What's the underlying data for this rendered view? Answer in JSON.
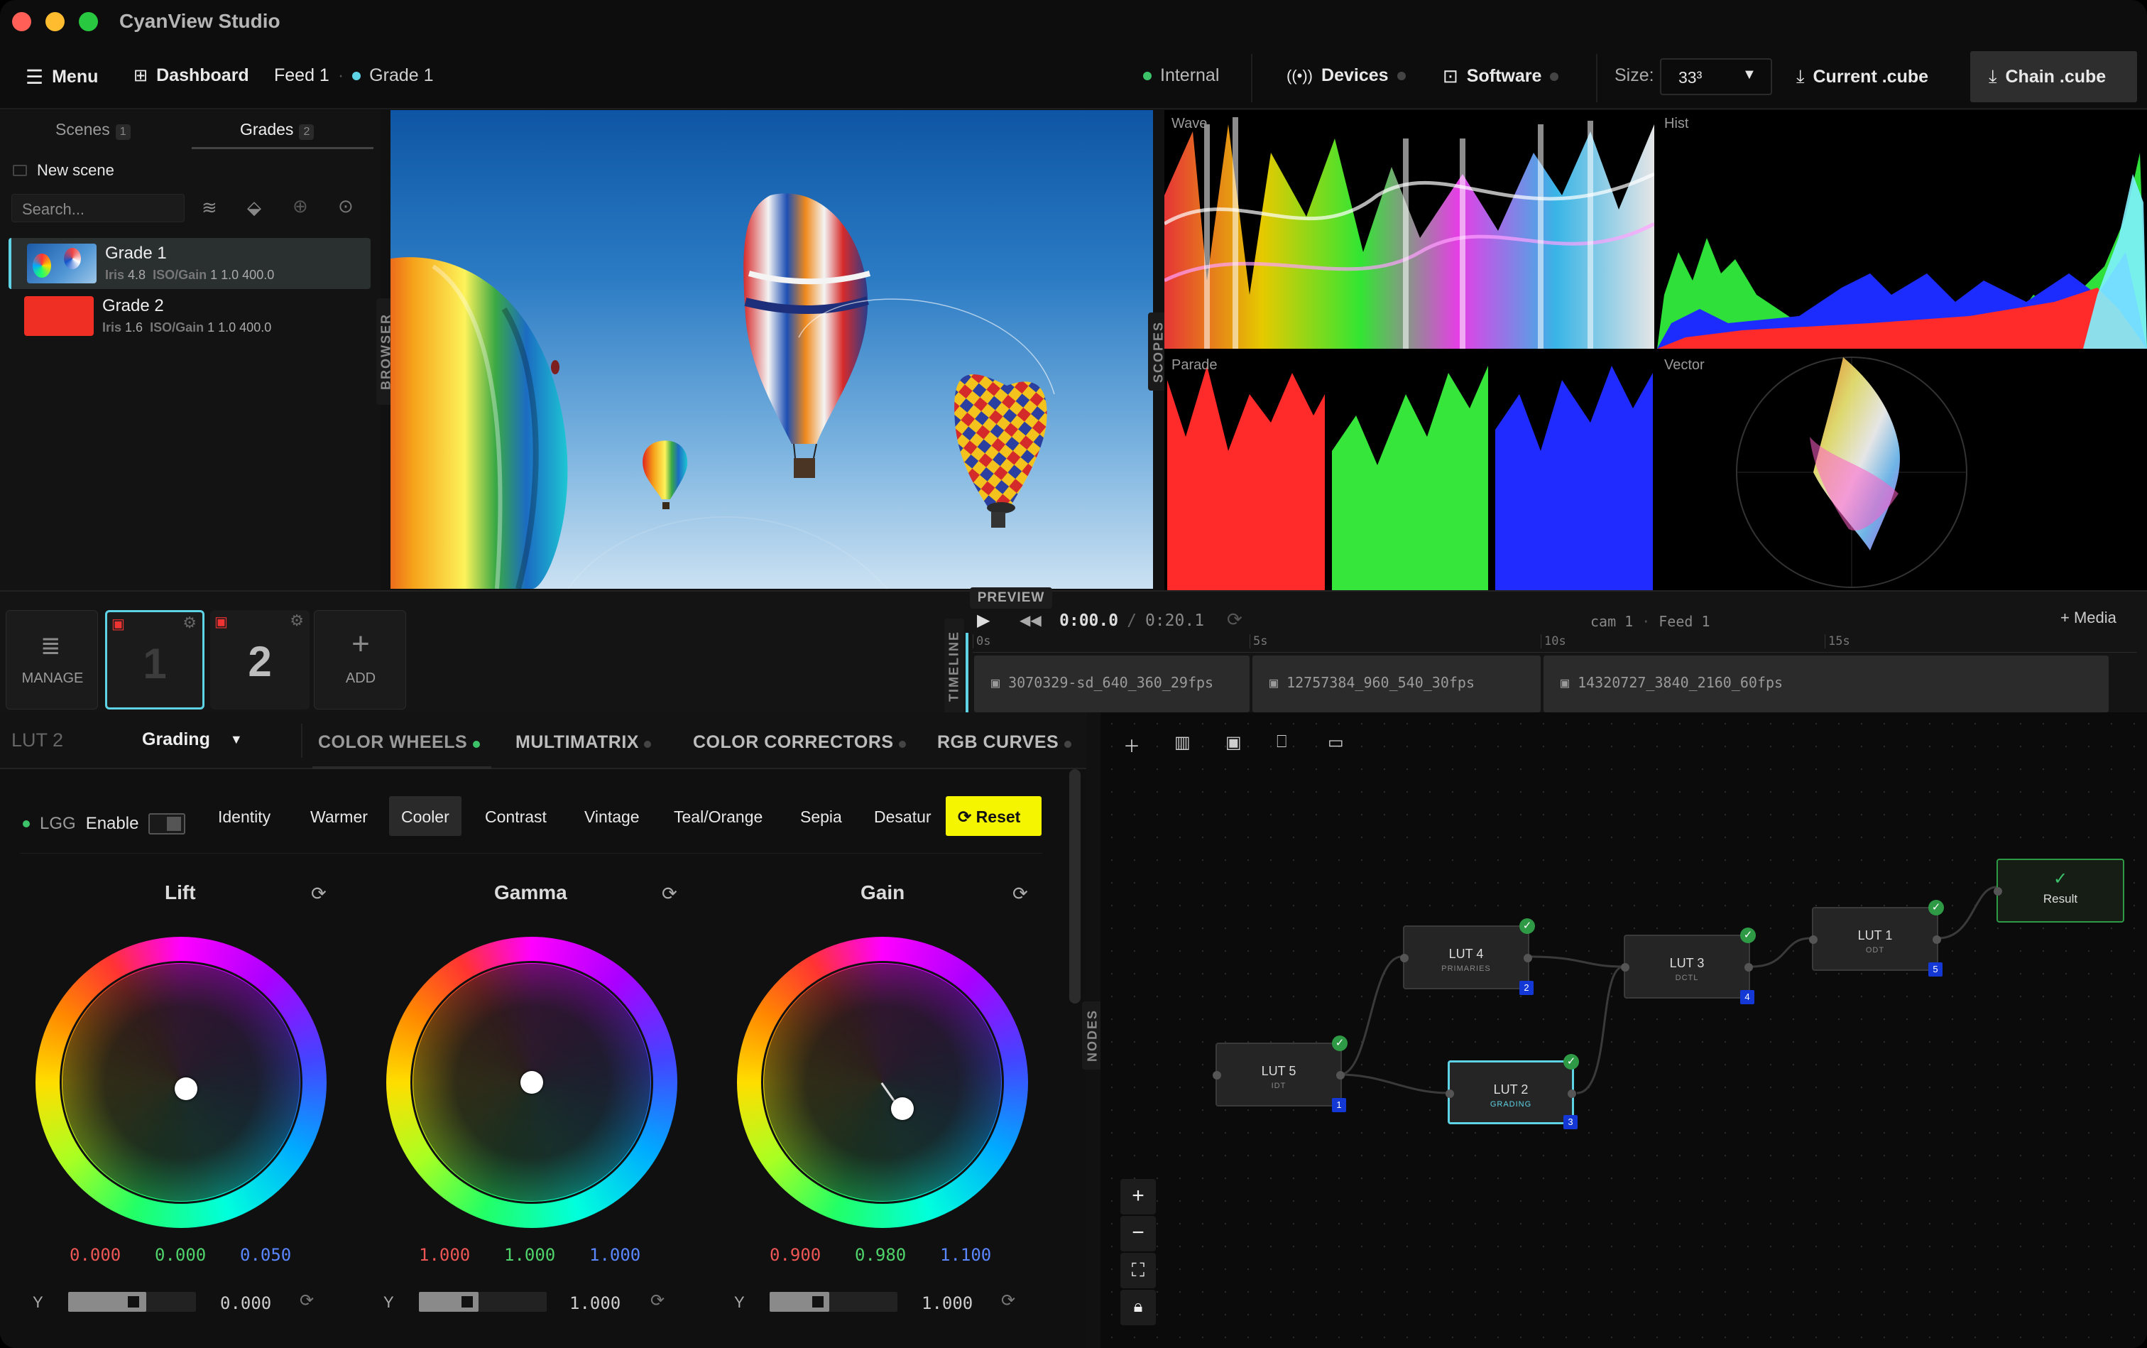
{
  "app": {
    "title": "CyanView Studio"
  },
  "toolbar": {
    "menu": "Menu",
    "dashboard": "Dashboard",
    "feed": "Feed 1",
    "grade": "Grade 1",
    "internal": "Internal",
    "devices": "Devices",
    "software": "Software",
    "size_label": "Size:",
    "size_value": "33³",
    "current_cube": "Current .cube",
    "chain_cube": "Chain .cube"
  },
  "sidebar": {
    "tabs": [
      {
        "label": "Scenes",
        "count": "1"
      },
      {
        "label": "Grades",
        "count": "2"
      }
    ],
    "new_scene": "New scene",
    "search_placeholder": "Search...",
    "grades": [
      {
        "name": "Grade 1",
        "meta": "Iris",
        "iris": "4.8",
        "gain": "ISO/Gain",
        "gainval": "1 1.0 400.0"
      },
      {
        "name": "Grade 2",
        "meta": "Iris",
        "iris": "1.6",
        "gain": "ISO/Gain",
        "gainval": "1 1.0 400.0"
      }
    ],
    "browser_tab": "BROWSER"
  },
  "scopes": {
    "tab": "SCOPES",
    "wave": "Wave",
    "hist": "Hist",
    "parade": "Parade",
    "vector": "Vector"
  },
  "strip": {
    "manage": "MANAGE",
    "cam1": "1",
    "cam2": "2",
    "add": "ADD",
    "preview": "PREVIEW",
    "timeline_tab": "TIMELINE",
    "time": "0:00.0",
    "duration": "0:20.1",
    "cam": "cam 1",
    "feed": "Feed 1",
    "media": "Media",
    "ticks": [
      "0s",
      "5s",
      "10s",
      "15s"
    ],
    "clips": [
      "3070329-sd_640_360_29fps",
      "12757384_960_540_30fps",
      "14320727_3840_2160_60fps"
    ]
  },
  "panel": {
    "lut": "LUT 2",
    "mode": "Grading",
    "tabs": [
      "COLOR WHEELS",
      "MULTIMATRIX",
      "COLOR CORRECTORS",
      "RGB CURVES"
    ],
    "lgg": "LGG",
    "enable": "Enable",
    "presets": [
      "Identity",
      "Warmer",
      "Cooler",
      "Contrast",
      "Vintage",
      "Teal/Orange",
      "Sepia",
      "Desatur"
    ],
    "reset": "Reset",
    "wheels": [
      {
        "title": "Lift",
        "r": "0.000",
        "g": "0.000",
        "b": "0.050",
        "y_label": "Y",
        "y": "0.000"
      },
      {
        "title": "Gamma",
        "r": "1.000",
        "g": "1.000",
        "b": "1.000",
        "y_label": "Y",
        "y": "1.000"
      },
      {
        "title": "Gain",
        "r": "0.900",
        "g": "0.980",
        "b": "1.100",
        "y_label": "Y",
        "y": "1.000"
      }
    ]
  },
  "nodes": {
    "tab": "NODES",
    "items": [
      {
        "title": "LUT 5",
        "sub": "IDT",
        "num": "1"
      },
      {
        "title": "LUT 4",
        "sub": "PRIMARIES",
        "num": "2"
      },
      {
        "title": "LUT 2",
        "sub": "GRADING",
        "num": "3"
      },
      {
        "title": "LUT 3",
        "sub": "DCTL",
        "num": "4"
      },
      {
        "title": "LUT 1",
        "sub": "ODT",
        "num": "5"
      }
    ],
    "result": "Result"
  },
  "colors": {
    "accent": "#5fd3e6",
    "green": "#3cc36a",
    "reset_yellow": "#f5f500"
  }
}
